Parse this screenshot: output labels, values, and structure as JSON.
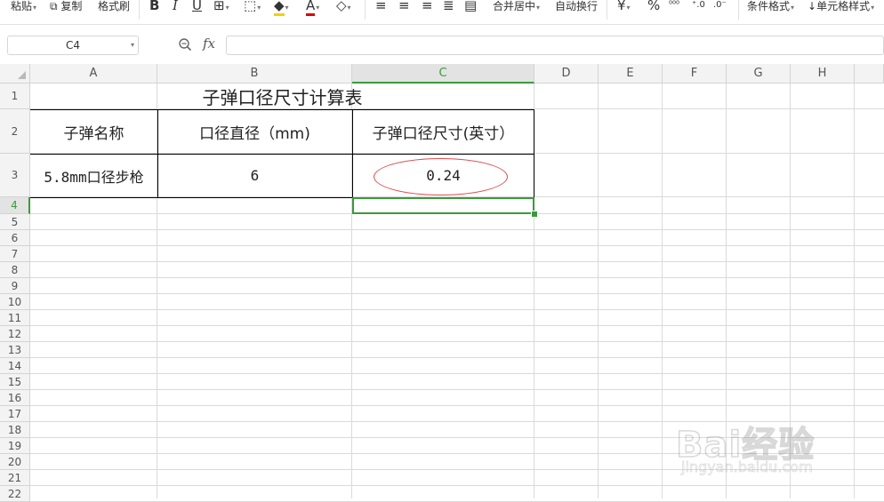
{
  "ribbon": {
    "paste_label": "粘贴",
    "copy_label": "复制",
    "format_painter_label": "格式刷",
    "bold_label": "B",
    "italic_label": "I",
    "underline_label": "U",
    "font_color_glyph": "A",
    "merge_center_label": "合并居中",
    "wrap_text_label": "自动换行",
    "currency_glyph": "¥",
    "percent_glyph": "%",
    "conditional_format_label": "条件格式",
    "cell_style_label": "单元格样式"
  },
  "formula_bar": {
    "name_box": "C4",
    "fx_label": "fx",
    "formula_value": ""
  },
  "columns": [
    "A",
    "B",
    "C",
    "D",
    "E",
    "F",
    "G",
    "H"
  ],
  "selected_column": "C",
  "rows": [
    "1",
    "2",
    "3",
    "4",
    "5",
    "6",
    "7",
    "8",
    "9",
    "10",
    "11",
    "12",
    "13",
    "14",
    "15",
    "16",
    "17",
    "18",
    "19",
    "20",
    "21",
    "22"
  ],
  "selected_row": "4",
  "sheet": {
    "title": "子弹口径尺寸计算表",
    "headers": [
      "子弹名称",
      "口径直径（mm)",
      "子弹口径尺寸(英寸）"
    ],
    "row3": [
      "5.8mm口径步枪",
      "6",
      "0.24"
    ]
  },
  "watermark": {
    "logo_text": "Bai经验",
    "url_text": "jingyan.baidu.com"
  },
  "colors": {
    "selection": "#3a9a3a",
    "annotation_oval": "#e04848",
    "header_bg": "#f3f3f3",
    "gridline": "#dadada"
  }
}
